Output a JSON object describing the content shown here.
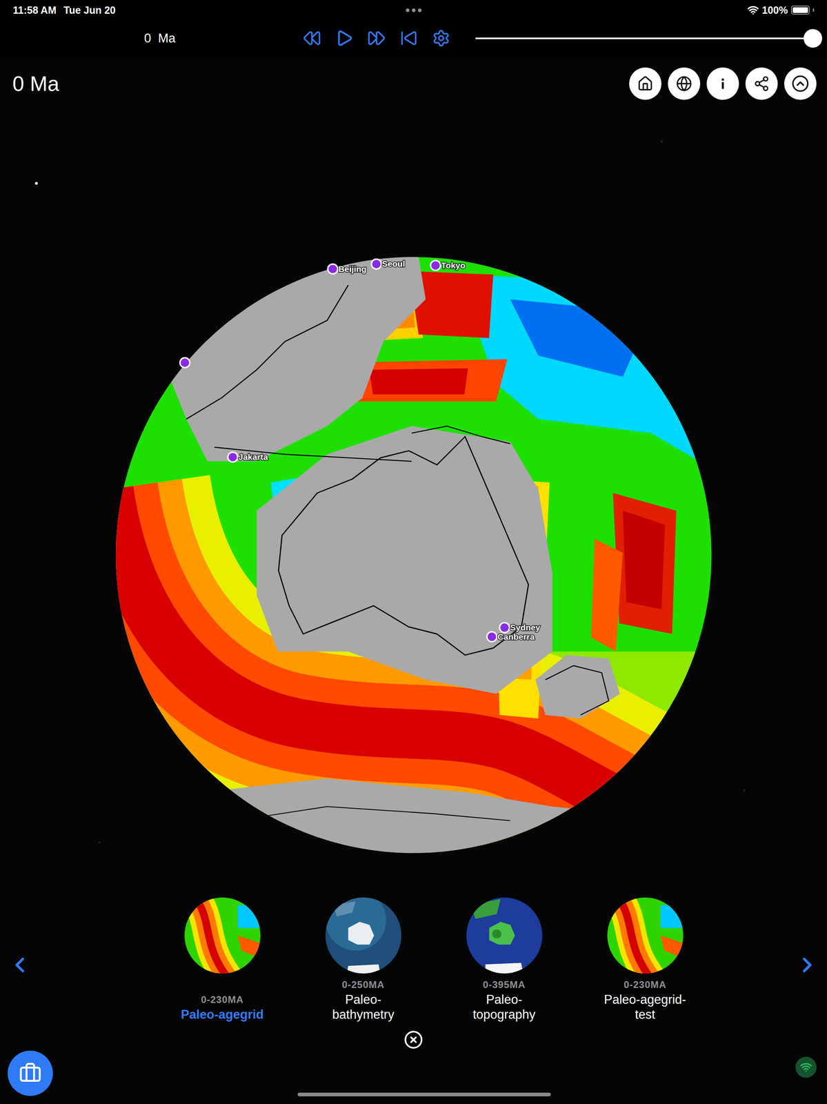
{
  "status_bar": {
    "time": "11:58 AM",
    "date": "Tue Jun 20",
    "battery": "100%",
    "battery_level": 1
  },
  "toolbar": {
    "time_label": "0  Ma",
    "playing": false,
    "slider_level": 1
  },
  "time_title": "0 Ma",
  "globe": {
    "cities": [
      {
        "label": "Beijing"
      },
      {
        "label": "Seoul"
      },
      {
        "label": "Tokyo"
      },
      {
        "label": "Jakarta"
      },
      {
        "label": "Sydney"
      },
      {
        "label": "Canberra"
      }
    ]
  },
  "layers": [
    {
      "range": "0-230MA",
      "title": "Paleo-agegrid",
      "selected": true,
      "kind": "agegrid"
    },
    {
      "range": "0-250MA",
      "title": "Paleo-bathymetry",
      "selected": false,
      "kind": "bathymetry"
    },
    {
      "range": "0-395MA",
      "title": "Paleo-topography",
      "selected": false,
      "kind": "topography"
    },
    {
      "range": "0-230MA",
      "title": "Paleo-agegrid-test",
      "selected": false,
      "kind": "agegrid"
    }
  ]
}
